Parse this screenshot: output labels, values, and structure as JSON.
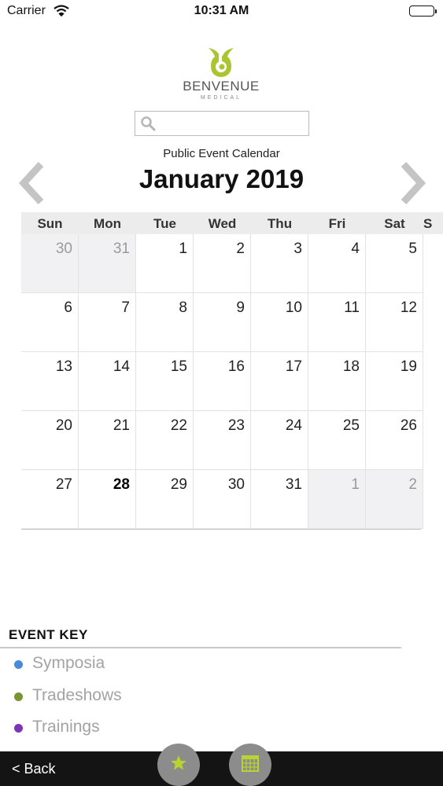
{
  "status_bar": {
    "carrier": "Carrier",
    "time": "10:31 AM"
  },
  "brand": {
    "name": "BENVENUE",
    "subtitle": "MEDICAL",
    "accent_color": "#a9c531"
  },
  "search": {
    "placeholder": "",
    "icon": "search-icon"
  },
  "calendar": {
    "subtitle": "Public Event Calendar",
    "month_title": "January 2019",
    "prev_icon": "chevron-left-icon",
    "next_icon": "chevron-right-icon",
    "weekdays": [
      "Sun",
      "Mon",
      "Tue",
      "Wed",
      "Thu",
      "Fri",
      "Sat",
      "S"
    ],
    "weeks": [
      [
        {
          "day": "30",
          "outside": true
        },
        {
          "day": "31",
          "outside": true
        },
        {
          "day": "1"
        },
        {
          "day": "2"
        },
        {
          "day": "3"
        },
        {
          "day": "4"
        },
        {
          "day": "5"
        }
      ],
      [
        {
          "day": "6"
        },
        {
          "day": "7"
        },
        {
          "day": "8"
        },
        {
          "day": "9"
        },
        {
          "day": "10"
        },
        {
          "day": "11"
        },
        {
          "day": "12"
        }
      ],
      [
        {
          "day": "13"
        },
        {
          "day": "14"
        },
        {
          "day": "15"
        },
        {
          "day": "16"
        },
        {
          "day": "17"
        },
        {
          "day": "18"
        },
        {
          "day": "19"
        }
      ],
      [
        {
          "day": "20"
        },
        {
          "day": "21"
        },
        {
          "day": "22"
        },
        {
          "day": "23"
        },
        {
          "day": "24"
        },
        {
          "day": "25"
        },
        {
          "day": "26"
        }
      ],
      [
        {
          "day": "27"
        },
        {
          "day": "28",
          "today": true
        },
        {
          "day": "29"
        },
        {
          "day": "30"
        },
        {
          "day": "31"
        },
        {
          "day": "1",
          "outside": true
        },
        {
          "day": "2",
          "outside": true
        }
      ]
    ]
  },
  "event_key": {
    "title": "EVENT KEY",
    "items": [
      {
        "label": "Symposia",
        "color": "#4a8ad8"
      },
      {
        "label": "Tradeshows",
        "color": "#7a9433"
      },
      {
        "label": "Trainings",
        "color": "#7b35b5"
      }
    ]
  },
  "bottom_bar": {
    "back_label": "< Back",
    "favorites_icon": "star-icon",
    "calendar_icon": "calendar-icon",
    "icon_color": "#b8d430"
  }
}
